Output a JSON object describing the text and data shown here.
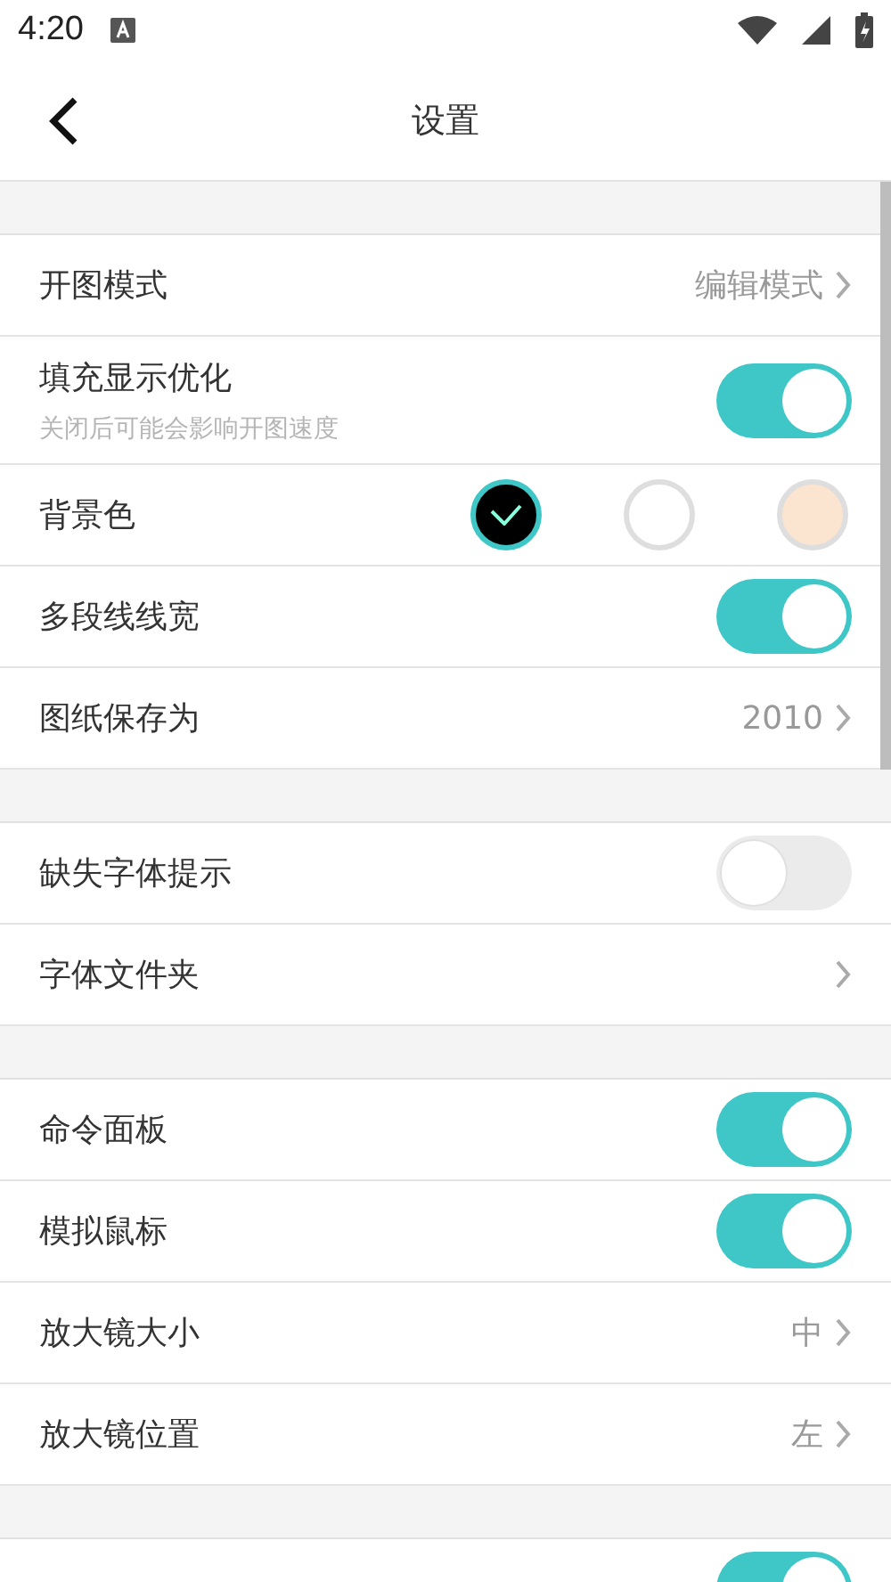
{
  "status_bar": {
    "time": "4:20"
  },
  "header": {
    "title": "设置"
  },
  "sections": [
    {
      "rows": [
        {
          "kind": "link",
          "label": "开图模式",
          "value": "编辑模式"
        },
        {
          "kind": "toggle",
          "label": "填充显示优化",
          "hint": "关闭后可能会影响开图速度",
          "on": true
        },
        {
          "kind": "colors",
          "label": "背景色",
          "options": [
            {
              "color": "#000000",
              "selected": true
            },
            {
              "color": "#ffffff",
              "selected": false
            },
            {
              "color": "#fce5d0",
              "selected": false
            }
          ]
        },
        {
          "kind": "toggle",
          "label": "多段线线宽",
          "on": true
        },
        {
          "kind": "link",
          "label": "图纸保存为",
          "value": "2010"
        }
      ]
    },
    {
      "rows": [
        {
          "kind": "toggle",
          "label": "缺失字体提示",
          "on": false
        },
        {
          "kind": "link",
          "label": "字体文件夹"
        }
      ]
    },
    {
      "rows": [
        {
          "kind": "toggle",
          "label": "命令面板",
          "on": true
        },
        {
          "kind": "toggle",
          "label": "模拟鼠标",
          "on": true
        },
        {
          "kind": "link",
          "label": "放大镜大小",
          "value": "中"
        },
        {
          "kind": "link",
          "label": "放大镜位置",
          "value": "左"
        }
      ]
    },
    {
      "rows": [
        {
          "kind": "toggle",
          "on": true
        }
      ]
    }
  ]
}
